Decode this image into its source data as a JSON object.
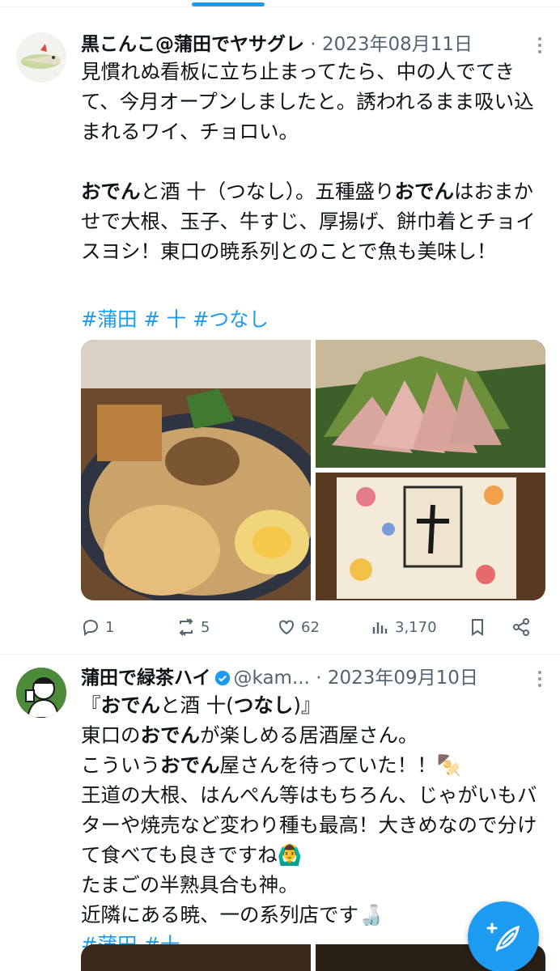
{
  "tweet1": {
    "display_name": "黒こんこ@蒲田でヤサグレ",
    "date_sep": " · ",
    "date": "2023年08月11日",
    "para1": "見慣れぬ看板に立ち止まってたら、中の人でてきて、今月オープンしましたと。誘われるまま吸い込まれるワイ、チョロい。",
    "para2_a": "おでん",
    "para2_b": "と酒 十（つなし）。五種盛り",
    "para2_c": "おでん",
    "para2_d": "はおまかせで大根、玉子、牛すじ、厚揚げ、餅巾着とチョイスヨシ！東口の暁系列とのことで魚も美味し！",
    "hashtags": "#蒲田  # 十 #つなし",
    "stats": {
      "replies": "1",
      "reposts": "5",
      "likes": "62",
      "views": "3,170"
    }
  },
  "tweet2": {
    "display_name": "蒲田で緑茶ハイ",
    "handle": "@kam...",
    "date_sep": " · ",
    "date": "2023年09月10日",
    "line1_a": "『",
    "line1_b": "おでん",
    "line1_c": "と酒 十(",
    "line1_d": "つなし",
    "line1_e": ")』",
    "line2_a": "東口の",
    "line2_b": "おでん",
    "line2_c": "が楽しめる居酒屋さん。",
    "line3_a": "こういう",
    "line3_b": "おでん",
    "line3_c": "屋さんを待っていた！！🍢",
    "line4": "王道の大根、はんぺん等はもちろん、じゃがいもバターや焼売など変わり種も最高！大きめなので分けて食べても良きですね🙆‍♂️",
    "line5": "たまごの半熟具合も神。",
    "line6": "近隣にある暁、一の系列店です🍶",
    "hashtags": "#蒲田 #十"
  },
  "colors": {
    "accent": "#1d9bf0",
    "text": "#0f1419",
    "muted": "#536471"
  },
  "icons": [
    "more-icon",
    "reply-icon",
    "repost-icon",
    "like-icon",
    "views-icon",
    "bookmark-icon",
    "share-icon",
    "verified-icon",
    "compose-icon"
  ]
}
